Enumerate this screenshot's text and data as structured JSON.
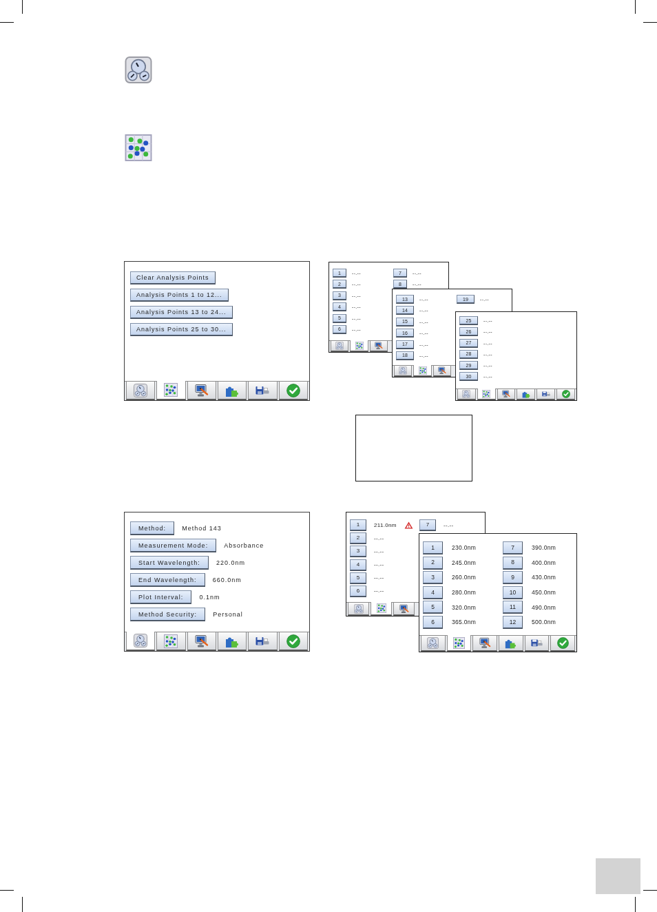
{
  "analysis_menu": {
    "buttons": [
      "Clear Analysis Points",
      "Analysis Points 1 to 12...",
      "Analysis Points 13 to 24...",
      "Analysis Points 25 to 30..."
    ],
    "toolbar": [
      {
        "selected": false
      },
      {
        "selected": true
      },
      {
        "selected": false
      },
      {
        "selected": false
      },
      {
        "selected": false
      },
      {
        "selected": false
      }
    ]
  },
  "points_stack": [
    {
      "columns": [
        [
          {
            "number": "1",
            "value": "--.--"
          },
          {
            "number": "2",
            "value": "--.--"
          },
          {
            "number": "3",
            "value": "--.--"
          },
          {
            "number": "4",
            "value": "--.--"
          },
          {
            "number": "5",
            "value": "--.--"
          },
          {
            "number": "6",
            "value": "--.--"
          }
        ],
        [
          {
            "number": "7",
            "value": "--.--"
          },
          {
            "number": "8",
            "value": "--.--"
          }
        ]
      ],
      "toolbar": [
        {
          "selected": false
        },
        {
          "selected": true
        },
        {
          "selected": false
        }
      ]
    },
    {
      "columns": [
        [
          {
            "number": "13",
            "value": "--.--"
          },
          {
            "number": "14",
            "value": "--.--"
          },
          {
            "number": "15",
            "value": "--.--"
          },
          {
            "number": "16",
            "value": "--.--"
          },
          {
            "number": "17",
            "value": "--.--"
          },
          {
            "number": "18",
            "value": "--.--"
          }
        ],
        [
          {
            "number": "19",
            "value": "--.--"
          }
        ]
      ],
      "toolbar": [
        {
          "selected": false
        },
        {
          "selected": true
        },
        {
          "selected": false
        }
      ]
    },
    {
      "columns": [
        [
          {
            "number": "25",
            "value": "--.--"
          },
          {
            "number": "26",
            "value": "--.--"
          },
          {
            "number": "27",
            "value": "--.--"
          },
          {
            "number": "28",
            "value": "--.--"
          },
          {
            "number": "29",
            "value": "--.--"
          },
          {
            "number": "30",
            "value": "--.--"
          }
        ]
      ],
      "toolbar": [
        {
          "selected": false
        },
        {
          "selected": true
        },
        {
          "selected": false
        },
        {
          "selected": false
        },
        {
          "selected": false
        },
        {
          "selected": false
        }
      ]
    }
  ],
  "method_screen": {
    "fields": [
      {
        "label": "Method:",
        "value": "Method 143"
      },
      {
        "label": "Measurement Mode:",
        "value": "Absorbance"
      },
      {
        "label": "Start Wavelength:",
        "value": "220.0nm"
      },
      {
        "label": "End Wavelength:",
        "value": "660.0nm"
      },
      {
        "label": "Plot Interval:",
        "value": "0.1nm"
      },
      {
        "label": "Method Security:",
        "value": "Personal"
      }
    ],
    "toolbar": [
      {
        "selected": true
      },
      {
        "selected": false
      },
      {
        "selected": false
      },
      {
        "selected": false
      },
      {
        "selected": false
      },
      {
        "selected": false
      }
    ]
  },
  "wavelength_stack": [
    {
      "columns": [
        [
          {
            "number": "1",
            "value": "211.0nm",
            "warning": true
          },
          {
            "number": "2",
            "value": "--.--",
            "warning": false
          },
          {
            "number": "3",
            "value": "--.--",
            "warning": false
          },
          {
            "number": "4",
            "value": "--.--",
            "warning": false
          },
          {
            "number": "5",
            "value": "--.--",
            "warning": false
          },
          {
            "number": "6",
            "value": "--.--",
            "warning": false
          }
        ],
        [
          {
            "number": "7",
            "value": "--.--",
            "warning": false
          }
        ]
      ],
      "toolbar": [
        {
          "selected": false
        },
        {
          "selected": true
        },
        {
          "selected": false
        }
      ]
    },
    {
      "columns": [
        [
          {
            "number": "1",
            "value": "230.0nm",
            "warning": false
          },
          {
            "number": "2",
            "value": "245.0nm",
            "warning": false
          },
          {
            "number": "3",
            "value": "260.0nm",
            "warning": false
          },
          {
            "number": "4",
            "value": "280.0nm",
            "warning": false
          },
          {
            "number": "5",
            "value": "320.0nm",
            "warning": false
          },
          {
            "number": "6",
            "value": "365.0nm",
            "warning": false
          }
        ],
        [
          {
            "number": "7",
            "value": "390.0nm",
            "warning": false
          },
          {
            "number": "8",
            "value": "400.0nm",
            "warning": false
          },
          {
            "number": "9",
            "value": "430.0nm",
            "warning": false
          },
          {
            "number": "10",
            "value": "450.0nm",
            "warning": false
          },
          {
            "number": "11",
            "value": "490.0nm",
            "warning": false
          },
          {
            "number": "12",
            "value": "500.0nm",
            "warning": false
          }
        ]
      ],
      "toolbar": [
        {
          "selected": false
        },
        {
          "selected": true
        },
        {
          "selected": false
        },
        {
          "selected": false
        },
        {
          "selected": false
        },
        {
          "selected": false
        }
      ]
    }
  ]
}
